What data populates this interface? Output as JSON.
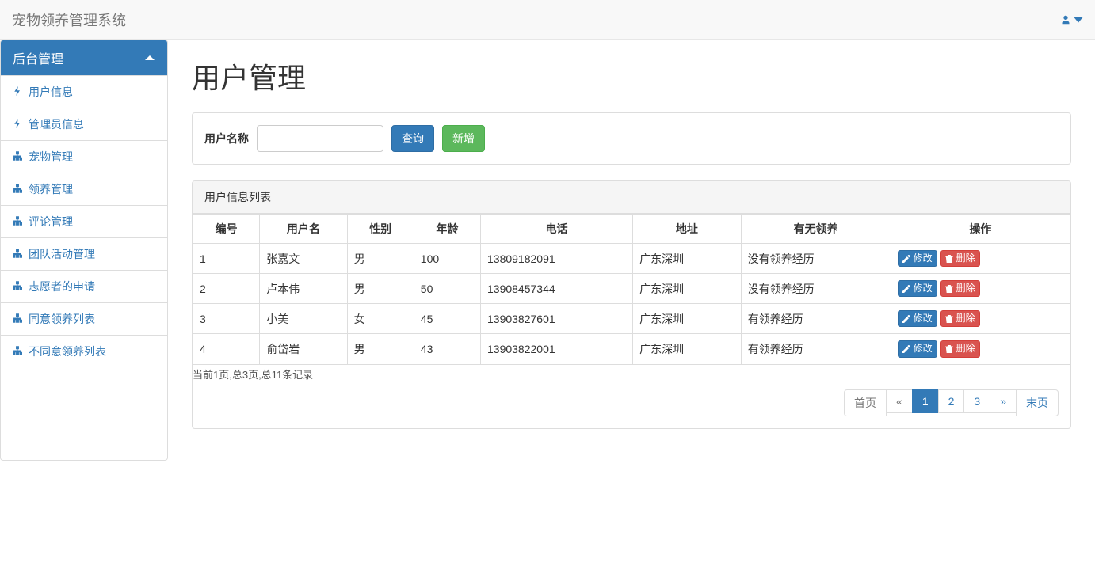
{
  "header": {
    "brand": "宠物领养管理系统"
  },
  "sidebar": {
    "heading": "后台管理",
    "items": [
      {
        "label": "用户信息",
        "icon": "flash"
      },
      {
        "label": "管理员信息",
        "icon": "flash"
      },
      {
        "label": "宠物管理",
        "icon": "sitemap"
      },
      {
        "label": "领养管理",
        "icon": "sitemap"
      },
      {
        "label": "评论管理",
        "icon": "sitemap"
      },
      {
        "label": "团队活动管理",
        "icon": "sitemap"
      },
      {
        "label": "志愿者的申请",
        "icon": "sitemap"
      },
      {
        "label": "同意领养列表",
        "icon": "sitemap"
      },
      {
        "label": "不同意领养列表",
        "icon": "sitemap"
      }
    ]
  },
  "page": {
    "title": "用户管理"
  },
  "search": {
    "label": "用户名称",
    "query_button": "查询",
    "add_button": "新增",
    "value": ""
  },
  "table": {
    "heading": "用户信息列表",
    "columns": [
      "编号",
      "用户名",
      "性别",
      "年龄",
      "电话",
      "地址",
      "有无领养",
      "操作"
    ],
    "rows": [
      {
        "id": "1",
        "username": "张嘉文",
        "gender": "男",
        "age": "100",
        "phone": "13809182091",
        "address": "广东深圳",
        "adoption": "没有领养经历"
      },
      {
        "id": "2",
        "username": "卢本伟",
        "gender": "男",
        "age": "50",
        "phone": "13908457344",
        "address": "广东深圳",
        "adoption": "没有领养经历"
      },
      {
        "id": "3",
        "username": "小美",
        "gender": "女",
        "age": "45",
        "phone": "13903827601",
        "address": "广东深圳",
        "adoption": "有领养经历"
      },
      {
        "id": "4",
        "username": "俞岱岩",
        "gender": "男",
        "age": "43",
        "phone": "13903822001",
        "address": "广东深圳",
        "adoption": "有领养经历"
      }
    ],
    "row_actions": {
      "edit": "修改",
      "delete": "删除"
    }
  },
  "pagination": {
    "info": "当前1页,总3页,总11条记录",
    "first": "首页",
    "last": "末页",
    "prev": "«",
    "next": "»",
    "pages": [
      "1",
      "2",
      "3"
    ],
    "current": "1"
  }
}
